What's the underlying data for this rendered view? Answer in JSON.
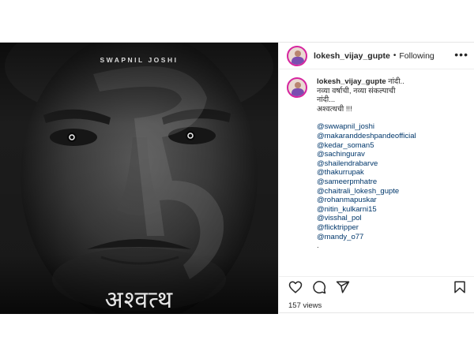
{
  "post": {
    "username": "lokesh_vijay_gupte",
    "separator": "•",
    "follow_status": "Following",
    "more_icon": "more-options-icon",
    "media": {
      "poster_name": "SWAPNIL JOSHI",
      "poster_title": "अश्वत्थ"
    },
    "caption": {
      "username": "lokesh_vijay_gupte",
      "line1": "नांदी..",
      "line2": "नव्या वर्षाची, नव्या संकल्पाची",
      "line3": "नांदी...",
      "line4": "अश्वत्थची !!!",
      "mentions": [
        "@swwapnil_joshi",
        "@makaranddeshpandeofficial",
        "@kedar_soman5",
        "@sachingurav",
        "@shailendrabarve",
        "@thakurrupak",
        "@sameerpmhatre",
        "@chaitrali_lokesh_gupte",
        "@rohanmapuskar",
        "@nitin_kulkarni15",
        "@visshal_pol",
        "@flicktripper",
        "@mandy_o77"
      ],
      "trailing": "."
    },
    "actions": {
      "like_icon": "heart-icon",
      "comment_icon": "comment-icon",
      "share_icon": "share-icon",
      "save_icon": "bookmark-icon"
    },
    "views": "157 views"
  }
}
